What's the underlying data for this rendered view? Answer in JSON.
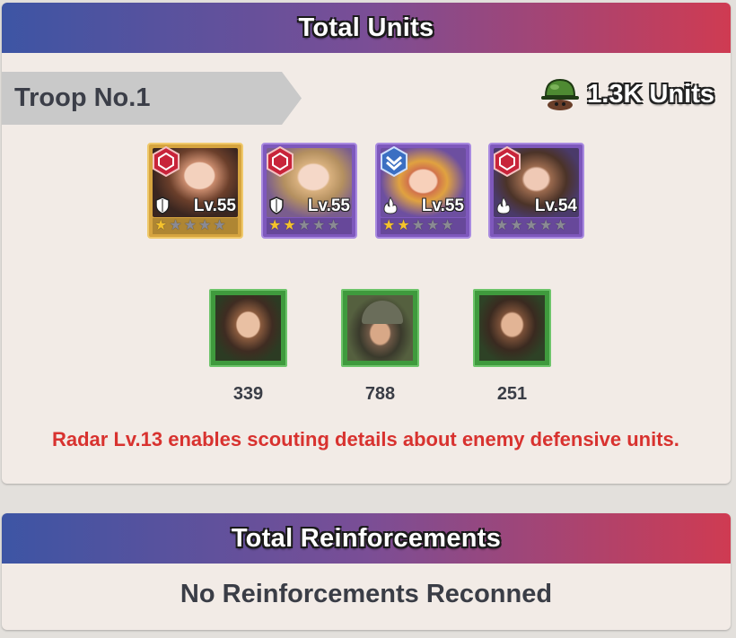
{
  "units_panel": {
    "title": "Total Units",
    "troop_label": "Troop No.1",
    "total_units": "1.3K Units",
    "heroes": [
      {
        "level": "Lv.55",
        "stars": 1,
        "rarity": "gold",
        "badge": "red-emblem",
        "type_icon": "shield-icon"
      },
      {
        "level": "Lv.55",
        "stars": 2,
        "rarity": "purple",
        "badge": "red-emblem",
        "type_icon": "shield-icon"
      },
      {
        "level": "Lv.55",
        "stars": 2,
        "rarity": "purple",
        "badge": "blue-chevron",
        "type_icon": "flame-icon"
      },
      {
        "level": "Lv.54",
        "stars": 0,
        "rarity": "purple",
        "badge": "red-emblem",
        "type_icon": "flame-icon"
      }
    ],
    "troops": [
      {
        "count": "339",
        "portrait": "female-goggles"
      },
      {
        "count": "788",
        "portrait": "helmet-soldier"
      },
      {
        "count": "251",
        "portrait": "male-soldier"
      }
    ],
    "note": "Radar Lv.13 enables scouting details about enemy defensive units."
  },
  "reinforcements_panel": {
    "title": "Total Reinforcements",
    "message": "No Reinforcements Reconned"
  },
  "colors": {
    "header_start": "#3d55a4",
    "header_end": "#cf3b52",
    "note": "#d8322f",
    "troop_card": "#3f9a3d",
    "gold_card": "#d6a43f",
    "purple_card": "#7e58bc"
  }
}
